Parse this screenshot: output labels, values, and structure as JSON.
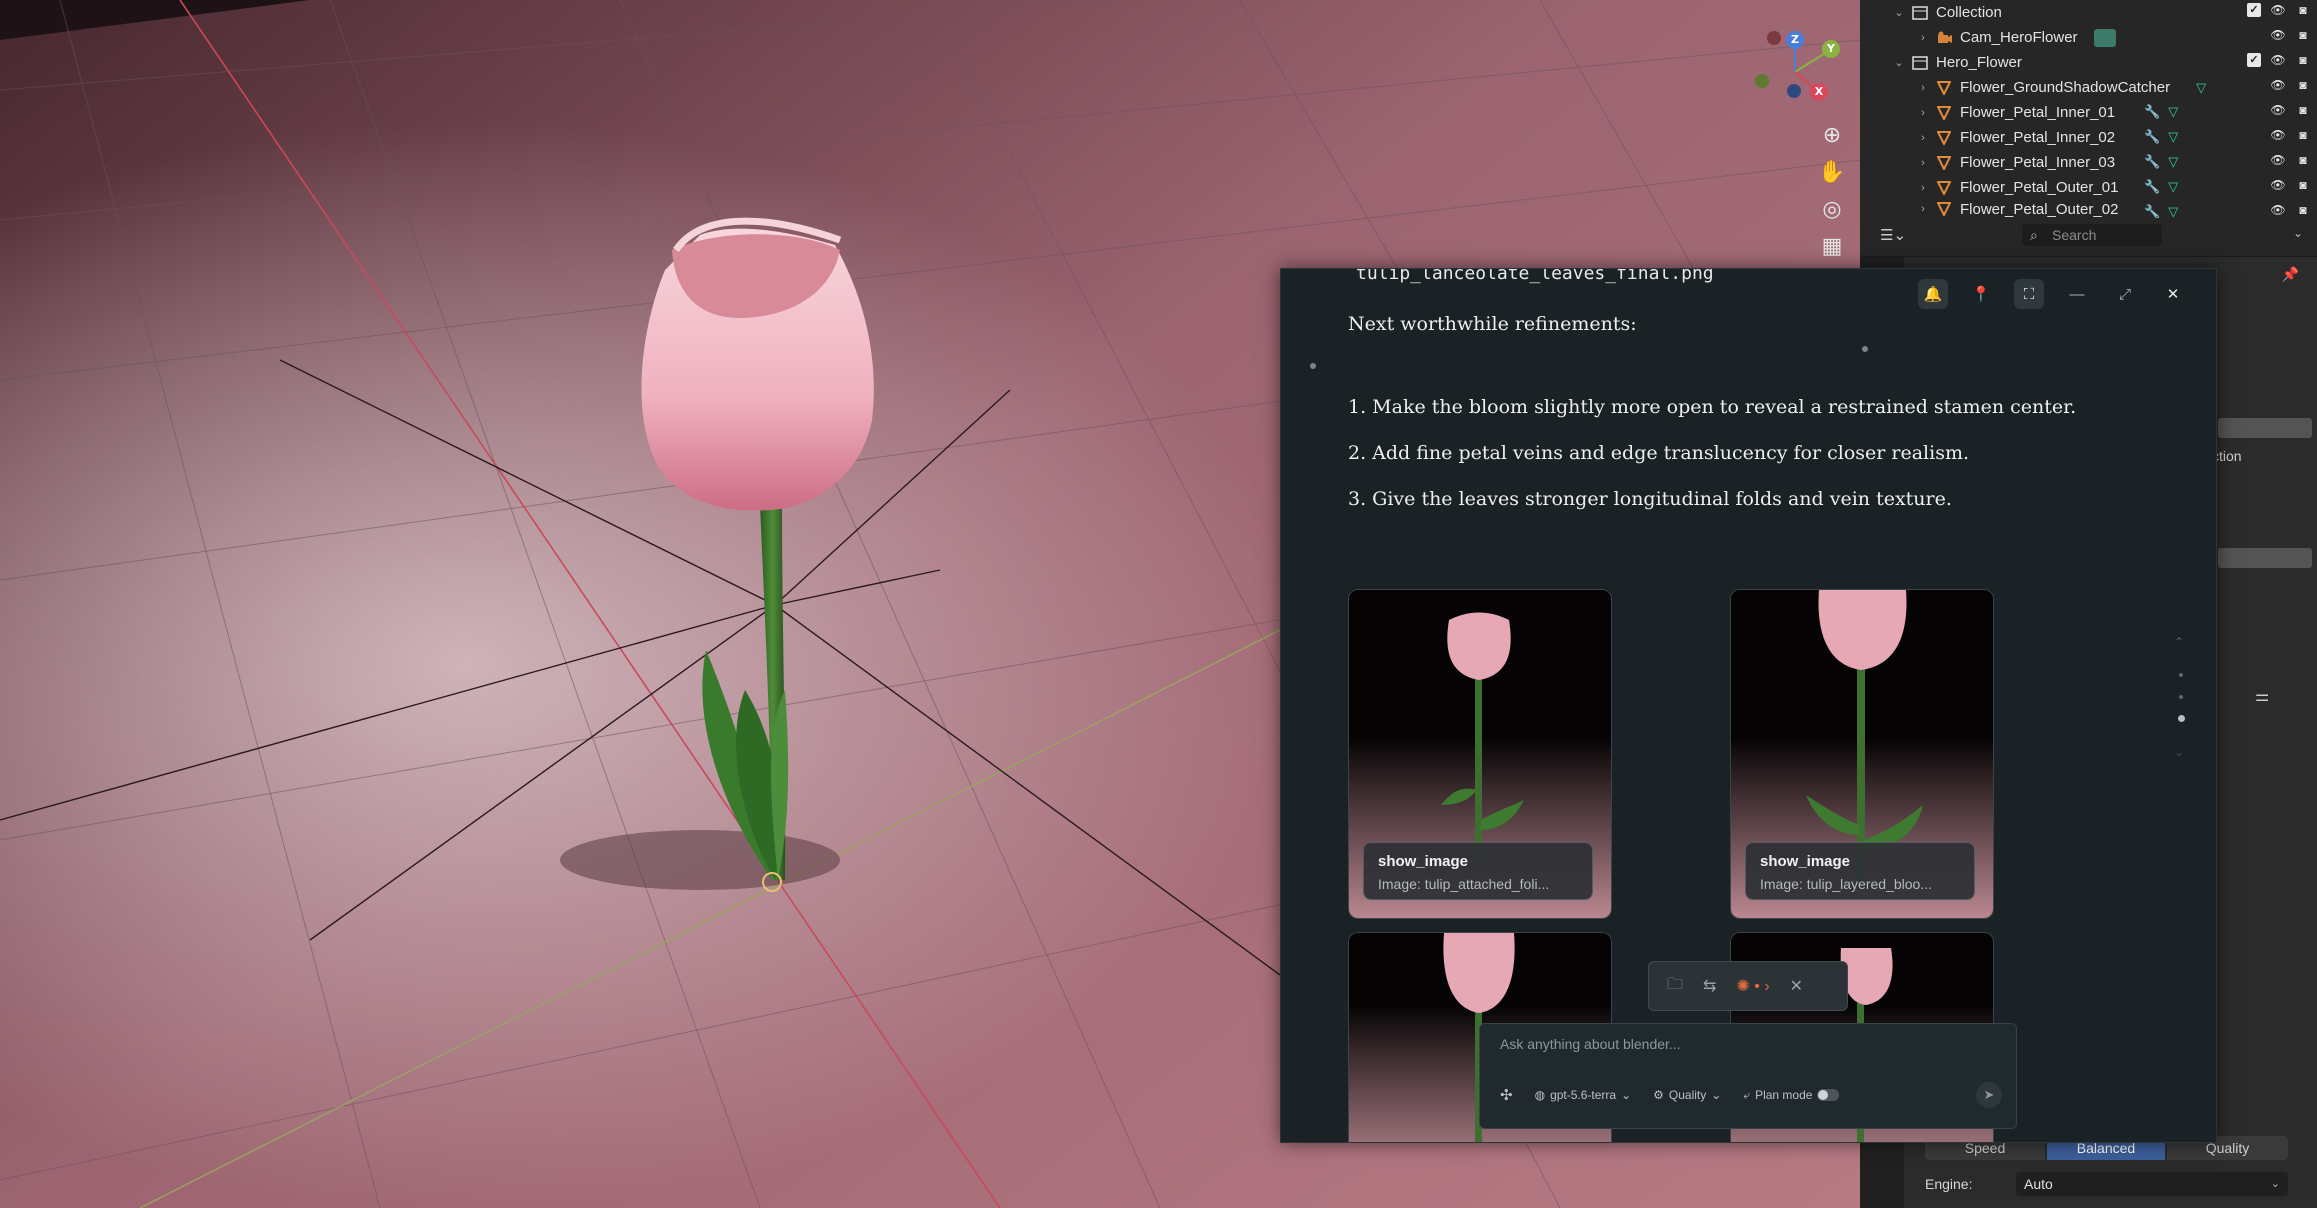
{
  "outliner": {
    "rows": [
      {
        "label": "Collection",
        "kind": "collection"
      },
      {
        "label": "Cam_HeroFlower",
        "kind": "camera"
      },
      {
        "label": "Hero_Flower",
        "kind": "collection"
      },
      {
        "label": "Flower_GroundShadowCatcher",
        "kind": "mesh"
      },
      {
        "label": "Flower_Petal_Inner_01",
        "kind": "mesh"
      },
      {
        "label": "Flower_Petal_Inner_02",
        "kind": "mesh"
      },
      {
        "label": "Flower_Petal_Inner_03",
        "kind": "mesh"
      },
      {
        "label": "Flower_Petal_Outer_01",
        "kind": "mesh"
      },
      {
        "label": "Flower_Petal_Outer_02",
        "kind": "mesh"
      }
    ]
  },
  "properties": {
    "search_placeholder": "Search",
    "partial_label": "ction",
    "render_modes": [
      "Speed",
      "Balanced",
      "Quality"
    ],
    "active_mode": "Balanced",
    "engine_label": "Engine:",
    "engine_value": "Auto"
  },
  "assistant": {
    "prev_filename": "tulip_lanceolate_leaves_final.png",
    "heading": "Next worthwhile refinements:",
    "refinements": [
      "1. Make the bloom slightly more open to reveal a restrained stamen center.",
      "2. Add fine petal veins and edge translucency for closer realism.",
      "3. Give the leaves stronger longitudinal folds and vein texture."
    ],
    "cards": [
      {
        "tool": "show_image",
        "subtitle": "Image: tulip_attached_foli..."
      },
      {
        "tool": "show_image",
        "subtitle": "Image: tulip_layered_bloo..."
      }
    ],
    "composer": {
      "placeholder": "Ask anything about blender...",
      "model": "gpt-5.6-terra",
      "quality": "Quality",
      "plan_mode": "Plan mode"
    }
  },
  "colors": {
    "accent_blue": "#3d5f9c",
    "assistant_bg": "#1a2226",
    "tulip_pink": "#f0b8c4",
    "stem_green": "#3d7a2e"
  }
}
